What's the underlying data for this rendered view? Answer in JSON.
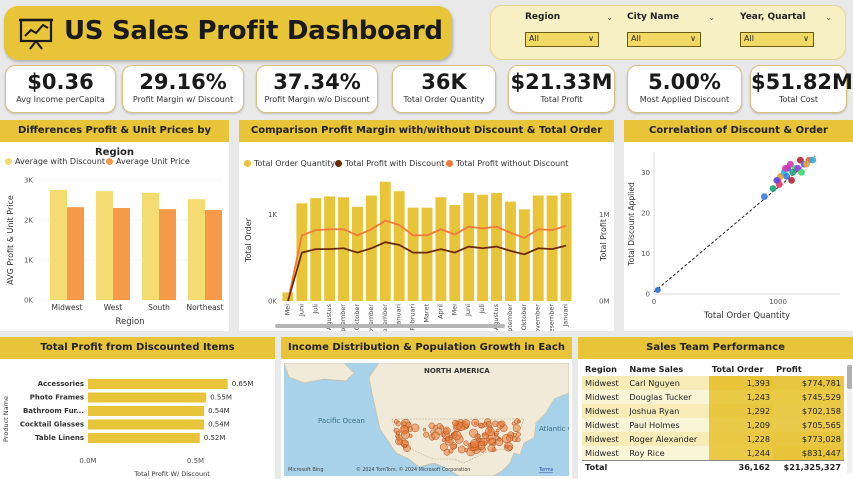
{
  "title": "US Sales Profit Dashboard",
  "filters": [
    {
      "label": "Region",
      "value": "All"
    },
    {
      "label": "City Name",
      "value": "All"
    },
    {
      "label": "Year, Quartal",
      "value": "All"
    }
  ],
  "kpis": [
    {
      "value": "$0.36",
      "label": "Avg Income perCapita"
    },
    {
      "value": "29.16%",
      "label": "Profit Margin w/ Discount"
    },
    {
      "value": "37.34%",
      "label": "Profit Margin w/o Discount"
    },
    {
      "value": "36K",
      "label": "Total Order Quantity"
    },
    {
      "value": "$21.33M",
      "label": "Total Profit"
    },
    {
      "value": "5.00%",
      "label": "Most Applied Discount"
    },
    {
      "value": "$51.82M",
      "label": "Total Cost"
    }
  ],
  "panels": {
    "region": "Differences Profit & Unit Prices by Region",
    "comparison": "Comparison Profit Margin with/without Discount & Total Order",
    "correlation": "Correlation of Discount & Order",
    "discounted": "Total Profit from Discounted Items",
    "income": "Income Distribution & Population Growth in Each City",
    "team": "Sales Team Performance"
  },
  "colors": {
    "yellow": "#e8c438",
    "bar_light": "#f5dc72",
    "bar_orange": "#f59a48",
    "dark_line": "#6b2a0a",
    "orange_line": "#f07a3a"
  },
  "chart_data": [
    {
      "type": "bar",
      "title": "Differences Profit & Unit Prices by Region",
      "categories": [
        "Midwest",
        "West",
        "South",
        "Northeast"
      ],
      "series": [
        {
          "name": "Average with Discount",
          "values": [
            2750,
            2720,
            2680,
            2520
          ]
        },
        {
          "name": "Average Unit Price",
          "values": [
            2320,
            2300,
            2270,
            2250
          ]
        }
      ],
      "xlabel": "Region",
      "ylabel": "AVG Profit & Unit Price",
      "yticks": [
        "0K",
        "1K",
        "2K",
        "3K"
      ],
      "ylim": [
        0,
        3000
      ]
    },
    {
      "type": "bar",
      "title": "Comparison Profit Margin with/without Discount & Total Order",
      "series_names": [
        "Total Order Quantity",
        "Total Profit with Discount",
        "Total Profit without Discount"
      ],
      "x_labels": [
        "Mei",
        "Juni",
        "Juli",
        "Agustus",
        "September",
        "Oktober",
        "November",
        "Desember",
        "Januari",
        "Februari",
        "Maret",
        "April",
        "Mei",
        "Juni",
        "Juli",
        "Agustus",
        "September",
        "Oktober",
        "November",
        "Desember",
        "Januari"
      ],
      "years": [
        "2018",
        "2019",
        "2..."
      ],
      "order_quantity": [
        100,
        1130,
        1190,
        1210,
        1200,
        1090,
        1220,
        1380,
        1270,
        1080,
        1080,
        1200,
        1110,
        1250,
        1230,
        1250,
        1150,
        1060,
        1220,
        1220,
        1250
      ],
      "profit_with_discount": [
        0,
        560000,
        600000,
        600000,
        610000,
        560000,
        610000,
        680000,
        650000,
        560000,
        560000,
        600000,
        560000,
        630000,
        610000,
        630000,
        580000,
        540000,
        610000,
        600000,
        640000
      ],
      "profit_without_discount": [
        0,
        760000,
        820000,
        830000,
        830000,
        760000,
        830000,
        930000,
        880000,
        760000,
        760000,
        830000,
        770000,
        860000,
        840000,
        860000,
        790000,
        730000,
        830000,
        820000,
        870000
      ],
      "y_left_ticks": [
        "0K",
        "1K"
      ],
      "y_right_ticks": [
        "0M",
        "1M"
      ],
      "xlabel": "Bulan",
      "ylabel_left": "Total Order",
      "ylabel_right": "Total Profit"
    },
    {
      "type": "scatter",
      "title": "Correlation of Discount & Order",
      "xlabel": "Total Order Quantity",
      "ylabel": "Total Discount Applied",
      "xticks": [
        "0",
        "1000"
      ],
      "yticks": [
        "0",
        "10",
        "20",
        "30"
      ],
      "xlim": [
        0,
        1500
      ],
      "ylim": [
        0,
        35
      ],
      "points": [
        [
          30,
          1
        ],
        [
          890,
          24
        ],
        [
          960,
          26
        ],
        [
          1000,
          28
        ],
        [
          1020,
          29
        ],
        [
          1050,
          30
        ],
        [
          1080,
          31
        ],
        [
          1100,
          32
        ],
        [
          1140,
          31
        ],
        [
          1180,
          33
        ],
        [
          1210,
          32
        ],
        [
          1250,
          33
        ],
        [
          1010,
          27
        ],
        [
          1070,
          29
        ],
        [
          1120,
          30
        ],
        [
          1160,
          31
        ],
        [
          1230,
          32
        ],
        [
          1280,
          33
        ],
        [
          990,
          28
        ],
        [
          1060,
          31
        ],
        [
          1190,
          30
        ],
        [
          1110,
          28
        ]
      ],
      "trendline": true
    },
    {
      "type": "bar",
      "title": "Total Profit from Discounted Items",
      "categories": [
        "Accessories",
        "Photo Frames",
        "Bathroom Fur...",
        "Cocktail Glasses",
        "Table Linens"
      ],
      "values": [
        0.65,
        0.55,
        0.54,
        0.54,
        0.52
      ],
      "value_labels": [
        "0.65M",
        "0.55M",
        "0.54M",
        "0.54M",
        "0.52M"
      ],
      "xticks": [
        "0.0M",
        "0.5M"
      ],
      "xlim": [
        0,
        0.8
      ],
      "xlabel": "Total Profit W/ Discount",
      "ylabel": "Product Name"
    }
  ],
  "map": {
    "label_na": "NORTH AMERICA",
    "label_pacific": "Pacific Ocean",
    "label_atlantic": "Atlantic Ocean",
    "attribution": "© 2024 TomTom, © 2024 Microsoft Corporation",
    "terms": "Terms",
    "logo": "Microsoft Bing"
  },
  "team": {
    "headers": [
      "Region",
      "Name Sales",
      "Total Order",
      "Profit"
    ],
    "rows": [
      [
        "Midwest",
        "Carl Nguyen",
        "1,393",
        "$774,781"
      ],
      [
        "Midwest",
        "Douglas Tucker",
        "1,243",
        "$745,529"
      ],
      [
        "Midwest",
        "Joshua Ryan",
        "1,292",
        "$702,158"
      ],
      [
        "Midwest",
        "Paul Holmes",
        "1,209",
        "$705,565"
      ],
      [
        "Midwest",
        "Roger Alexander",
        "1,228",
        "$773,028"
      ],
      [
        "Midwest",
        "Roy Rice",
        "1,244",
        "$831,447"
      ]
    ],
    "total": [
      "Total",
      "",
      "36,162",
      "$21,325,327"
    ]
  }
}
